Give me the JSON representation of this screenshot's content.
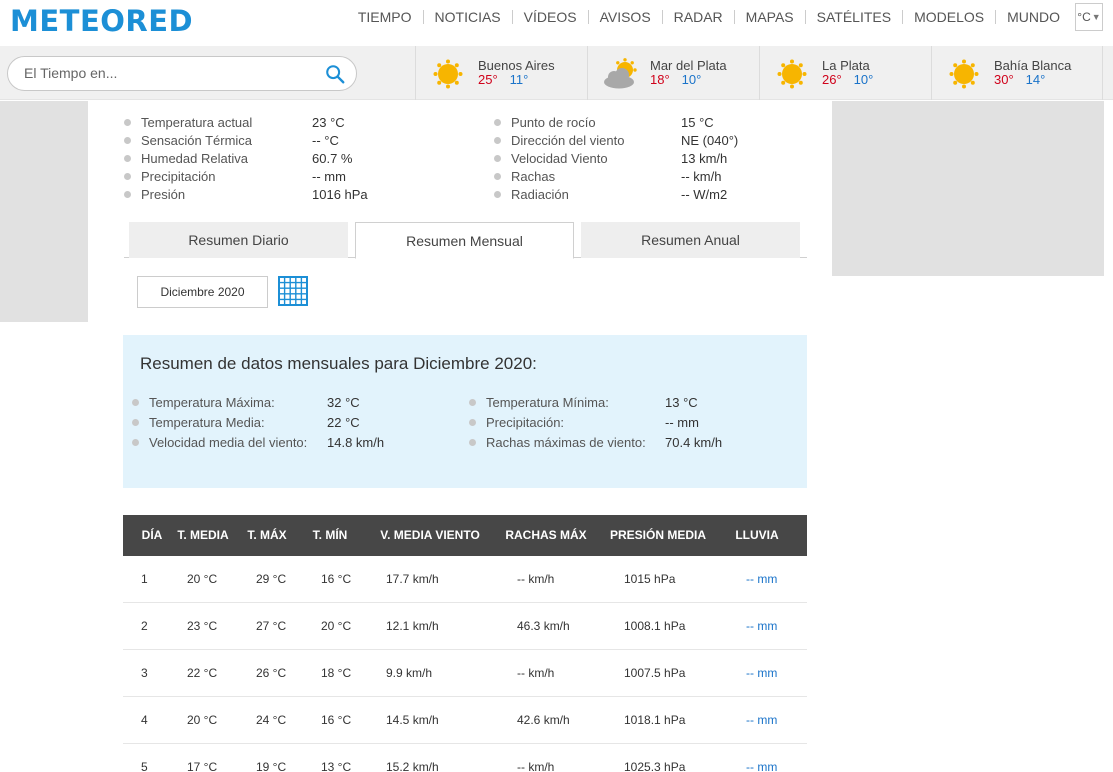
{
  "header": {
    "logo": "METEORED",
    "nav": [
      "TIEMPO",
      "NOTICIAS",
      "VÍDEOS",
      "AVISOS",
      "RADAR",
      "MAPAS",
      "SATÉLITES",
      "MODELOS",
      "MUNDO"
    ],
    "unit": "°C"
  },
  "search": {
    "placeholder": "El Tiempo en..."
  },
  "cities": [
    {
      "name": "Buenos Aires",
      "max": "25°",
      "min": "11°",
      "icon": "sun-icon"
    },
    {
      "name": "Mar del Plata",
      "max": "18°",
      "min": "10°",
      "icon": "cloud-sun-icon"
    },
    {
      "name": "La Plata",
      "max": "26°",
      "min": "10°",
      "icon": "sun-icon"
    },
    {
      "name": "Bahía Blanca",
      "max": "30°",
      "min": "14°",
      "icon": "sun-icon"
    }
  ],
  "current": {
    "left": [
      {
        "label": "Temperatura actual",
        "value": "23 °C"
      },
      {
        "label": "Sensación Térmica",
        "value": "-- °C"
      },
      {
        "label": "Humedad Relativa",
        "value": "60.7 %"
      },
      {
        "label": "Precipitación",
        "value": "-- mm"
      },
      {
        "label": "Presión",
        "value": "1016 hPa"
      }
    ],
    "right": [
      {
        "label": "Punto de rocío",
        "value": "15 °C"
      },
      {
        "label": "Dirección del viento",
        "value": "NE (040°)"
      },
      {
        "label": "Velocidad Viento",
        "value": "13 km/h"
      },
      {
        "label": "Rachas",
        "value": "-- km/h"
      },
      {
        "label": "Radiación",
        "value": "-- W/m2"
      }
    ]
  },
  "tabs": [
    "Resumen Diario",
    "Resumen Mensual",
    "Resumen Anual"
  ],
  "active_tab": 1,
  "month": {
    "value": "Diciembre 2020"
  },
  "summary": {
    "title": "Resumen de datos mensuales para Diciembre 2020:",
    "left": [
      {
        "label": "Temperatura Máxima:",
        "value": "32 °C"
      },
      {
        "label": "Temperatura Media:",
        "value": "22 °C"
      },
      {
        "label": "Velocidad media del viento:",
        "value": "14.8 km/h"
      }
    ],
    "right": [
      {
        "label": "Temperatura Mínima:",
        "value": "13 °C"
      },
      {
        "label": "Precipitación:",
        "value": "-- mm"
      },
      {
        "label": "Rachas máximas de viento:",
        "value": "70.4 km/h"
      }
    ]
  },
  "table": {
    "headers": [
      "DÍA",
      "T. MEDIA",
      "T. MÁX",
      "T. MÍN",
      "V. MEDIA VIENTO",
      "RACHAS MÁX",
      "PRESIÓN MEDIA",
      "LLUVIA"
    ],
    "rows": [
      [
        "1",
        "20 °C",
        "29 °C",
        "16 °C",
        "17.7 km/h",
        "-- km/h",
        "1015 hPa",
        "-- mm"
      ],
      [
        "2",
        "23 °C",
        "27 °C",
        "20 °C",
        "12.1 km/h",
        "46.3 km/h",
        "1008.1 hPa",
        "-- mm"
      ],
      [
        "3",
        "22 °C",
        "26 °C",
        "18 °C",
        "9.9 km/h",
        "-- km/h",
        "1007.5 hPa",
        "-- mm"
      ],
      [
        "4",
        "20 °C",
        "24 °C",
        "16 °C",
        "14.5 km/h",
        "42.6 km/h",
        "1018.1 hPa",
        "-- mm"
      ],
      [
        "5",
        "17 °C",
        "19 °C",
        "13 °C",
        "15.2 km/h",
        "-- km/h",
        "1025.3 hPa",
        "-- mm"
      ]
    ]
  },
  "colors": {
    "brand": "#1c8fd6",
    "max_temp": "#d0021b",
    "min_temp": "#1a73c9",
    "summary_bg": "#e2f3fc",
    "table_header_bg": "#474747"
  }
}
